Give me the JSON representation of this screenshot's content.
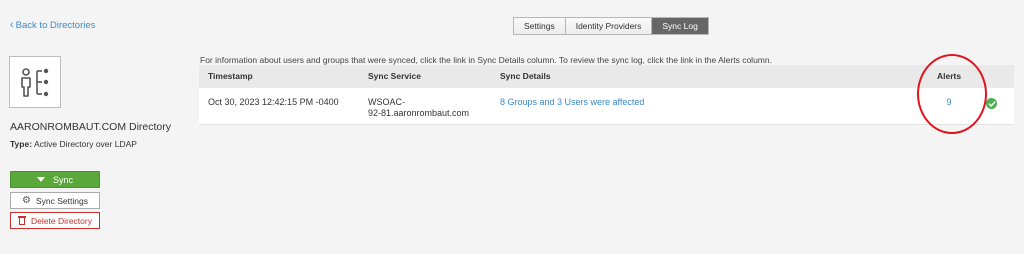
{
  "nav": {
    "back_label": "Back to Directories"
  },
  "tabs": [
    {
      "label": "Settings",
      "active": false
    },
    {
      "label": "Identity Providers",
      "active": false
    },
    {
      "label": "Sync Log",
      "active": true
    }
  ],
  "directory": {
    "icon": "directory-org-icon",
    "name": "AARONROMBAUT.COM Directory",
    "type_label": "Type:",
    "type_value": "Active Directory over LDAP"
  },
  "actions": {
    "sync_label": "Sync",
    "sync_settings_label": "Sync Settings",
    "delete_label": "Delete Directory"
  },
  "sync_log": {
    "info": "For information about users and groups that were synced, click the link in Sync Details column. To review the sync log, click the link in the Alerts column.",
    "columns": {
      "timestamp": "Timestamp",
      "service": "Sync Service",
      "details": "Sync Details",
      "alerts": "Alerts"
    },
    "rows": [
      {
        "timestamp": "Oct 30, 2023 12:42:15 PM -0400",
        "service_line1": "WSOAC-",
        "service_line2": "92-81.aaronrombaut.com",
        "details": "8 Groups and 3 Users were affected",
        "alerts": "9",
        "status": "success"
      }
    ]
  },
  "colors": {
    "accent": "#3a8ac8",
    "sync_button": "#5aa83a",
    "delete": "#c9302c",
    "success": "#4caf50",
    "annotation": "#e0141c"
  }
}
